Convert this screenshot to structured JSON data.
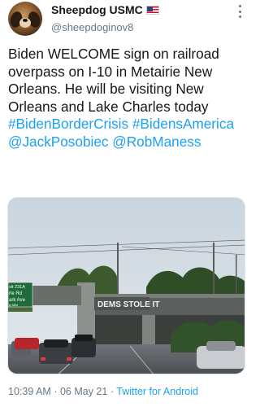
{
  "author": {
    "display_name": "Sheepdog USMC",
    "handle": "@sheepdoginov8",
    "flag_emoji": "us-flag-icon"
  },
  "tweet": {
    "text_plain": "Biden WELCOME sign on railroad overpass on I-10 in Metairie New Orleans. He will be visiting New Orleans and Lake Charles today",
    "hashtags": [
      "#BidenBorderCrisis",
      "#BidensAmerica"
    ],
    "mentions": [
      "@JackPosobiec",
      "@RobManess"
    ]
  },
  "media": {
    "sign_text": "DEMS STOLE IT",
    "highway_sign_lines": [
      "xit 231A",
      "rle Rd",
      "ark Ave",
      "ly Mile"
    ]
  },
  "meta": {
    "time": "10:39 AM",
    "separator": "·",
    "date": "06 May 21",
    "source": "Twitter for Android"
  },
  "colors": {
    "link": "#1da1f2",
    "secondary_text": "#657786",
    "primary_text": "#14171a"
  }
}
